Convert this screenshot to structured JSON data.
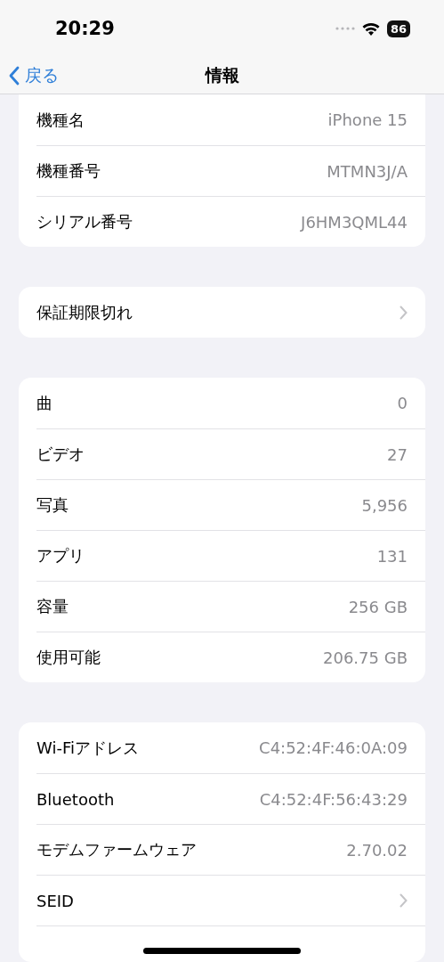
{
  "status_bar": {
    "time": "20:29",
    "battery": "86"
  },
  "nav": {
    "back": "戻る",
    "title": "情報"
  },
  "sections": [
    {
      "rows": [
        {
          "kind": "value",
          "label": "機種名",
          "value": "iPhone 15"
        },
        {
          "kind": "value",
          "label": "機種番号",
          "value": "MTMN3J/A"
        },
        {
          "kind": "value",
          "label": "シリアル番号",
          "value": "J6HM3QML44"
        }
      ]
    },
    {
      "rows": [
        {
          "kind": "link",
          "label": "保証期限切れ"
        }
      ]
    },
    {
      "rows": [
        {
          "kind": "value",
          "label": "曲",
          "value": "0"
        },
        {
          "kind": "value",
          "label": "ビデオ",
          "value": "27"
        },
        {
          "kind": "value",
          "label": "写真",
          "value": "5,956"
        },
        {
          "kind": "value",
          "label": "アプリ",
          "value": "131"
        },
        {
          "kind": "value",
          "label": "容量",
          "value": "256 GB"
        },
        {
          "kind": "value",
          "label": "使用可能",
          "value": "206.75 GB"
        }
      ]
    },
    {
      "rows": [
        {
          "kind": "value",
          "label": "Wi-Fiアドレス",
          "value": "C4:52:4F:46:0A:09"
        },
        {
          "kind": "value",
          "label": "Bluetooth",
          "value": "C4:52:4F:56:43:29"
        },
        {
          "kind": "value",
          "label": "モデムファームウェア",
          "value": "2.70.02"
        },
        {
          "kind": "link",
          "label": "SEID"
        }
      ]
    }
  ]
}
